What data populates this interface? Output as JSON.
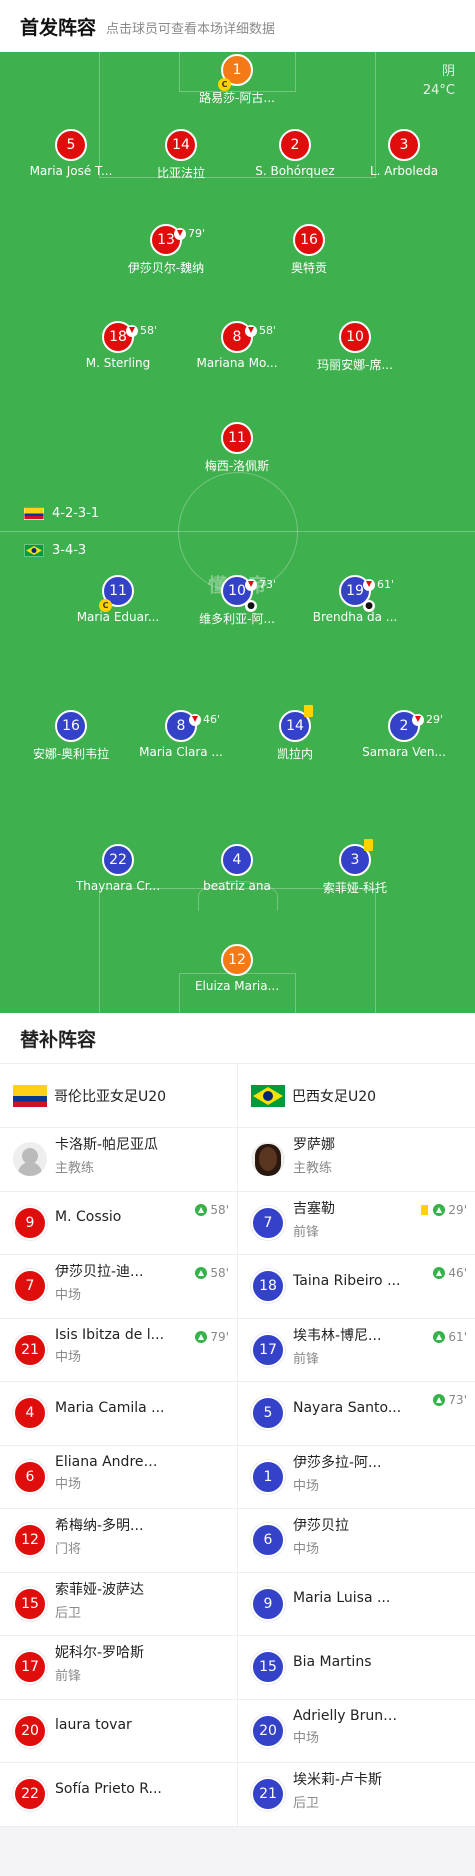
{
  "header": {
    "title": "首发阵容",
    "subtitle": "点击球员可查看本场详细数据"
  },
  "weather": {
    "condition": "阴",
    "temp": "24°C"
  },
  "watermark": "懂球帝",
  "formations": {
    "home": "4-2-3-1",
    "away": "3-4-3"
  },
  "colors": {
    "home": "#e00d0d",
    "away": "#3441c9",
    "goalkeeper": "#f47a17",
    "pitch": "#3fb04e"
  },
  "home_lineup": [
    {
      "number": "1",
      "name": "路易莎-阿古...",
      "gk": true,
      "captain": true
    },
    {
      "number": "5",
      "name": "Maria José T..."
    },
    {
      "number": "14",
      "name": "比亚法拉"
    },
    {
      "number": "2",
      "name": "S. Bohórquez"
    },
    {
      "number": "3",
      "name": "L. Arboleda"
    },
    {
      "number": "13",
      "name": "伊莎贝尔-魏纳",
      "sub_off": "79'"
    },
    {
      "number": "16",
      "name": "奥特贡"
    },
    {
      "number": "18",
      "name": "M. Sterling",
      "sub_off": "58'"
    },
    {
      "number": "8",
      "name": "Mariana Mo...",
      "sub_off": "58'"
    },
    {
      "number": "10",
      "name": "玛丽安娜-席..."
    },
    {
      "number": "11",
      "name": "梅西-洛佩斯"
    }
  ],
  "away_lineup": [
    {
      "number": "11",
      "name": "Maria Eduar...",
      "captain": true
    },
    {
      "number": "10",
      "name": "维多利亚-阿...",
      "sub_off": "73'",
      "goal": true
    },
    {
      "number": "19",
      "name": "Brendha da ...",
      "sub_off": "61'",
      "goal": true
    },
    {
      "number": "16",
      "name": "安娜-奥利韦拉"
    },
    {
      "number": "8",
      "name": "Maria Clara ...",
      "sub_off": "46'"
    },
    {
      "number": "14",
      "name": "凯拉内",
      "yellow": true
    },
    {
      "number": "2",
      "name": "Samara Ven...",
      "sub_off": "29'"
    },
    {
      "number": "22",
      "name": "Thaynara Cr..."
    },
    {
      "number": "4",
      "name": "beatriz ana"
    },
    {
      "number": "3",
      "name": "索菲娅-科托",
      "yellow": true
    },
    {
      "number": "12",
      "name": "Eluiza Maria...",
      "gk": true
    }
  ],
  "subs": {
    "title": "替补阵容",
    "home_team": "哥伦比亚女足U20",
    "away_team": "巴西女足U20",
    "home_coach": {
      "name": "卡洛斯-帕尼亚瓜",
      "role": "主教练"
    },
    "away_coach": {
      "name": "罗萨娜",
      "role": "主教练"
    },
    "home": [
      {
        "number": "9",
        "name": "M. Cossio",
        "pos": "",
        "sub_in": "58'"
      },
      {
        "number": "7",
        "name": "伊莎贝拉-迪...",
        "pos": "中场",
        "sub_in": "58'"
      },
      {
        "number": "21",
        "name": "Isis Ibitza de l...",
        "pos": "中场",
        "sub_in": "79'"
      },
      {
        "number": "4",
        "name": "Maria Camila ...",
        "pos": ""
      },
      {
        "number": "6",
        "name": "Eliana Andrea...",
        "pos": "中场"
      },
      {
        "number": "12",
        "name": "希梅纳-多明...",
        "pos": "门将"
      },
      {
        "number": "15",
        "name": "索菲娅-波萨达",
        "pos": "后卫"
      },
      {
        "number": "17",
        "name": "妮科尔-罗哈斯",
        "pos": "前锋"
      },
      {
        "number": "20",
        "name": "laura tovar",
        "pos": ""
      },
      {
        "number": "22",
        "name": "Sofía Prieto R...",
        "pos": ""
      }
    ],
    "away": [
      {
        "number": "7",
        "name": "吉塞勒",
        "pos": "前锋",
        "sub_in": "29'",
        "yellow": true
      },
      {
        "number": "18",
        "name": "Taina Ribeiro ...",
        "pos": "",
        "sub_in": "46'"
      },
      {
        "number": "17",
        "name": "埃韦林-博尼...",
        "pos": "前锋",
        "sub_in": "61'"
      },
      {
        "number": "5",
        "name": "Nayara Santo...",
        "pos": "",
        "sub_in": "73'"
      },
      {
        "number": "1",
        "name": "伊莎多拉-阿...",
        "pos": "中场"
      },
      {
        "number": "6",
        "name": "伊莎贝拉",
        "pos": "中场"
      },
      {
        "number": "9",
        "name": "Maria Luisa ...",
        "pos": ""
      },
      {
        "number": "15",
        "name": "Bia Martins",
        "pos": ""
      },
      {
        "number": "20",
        "name": "Adrielly Bruna...",
        "pos": "中场"
      },
      {
        "number": "21",
        "name": "埃米莉-卢卡斯",
        "pos": "后卫"
      }
    ]
  }
}
